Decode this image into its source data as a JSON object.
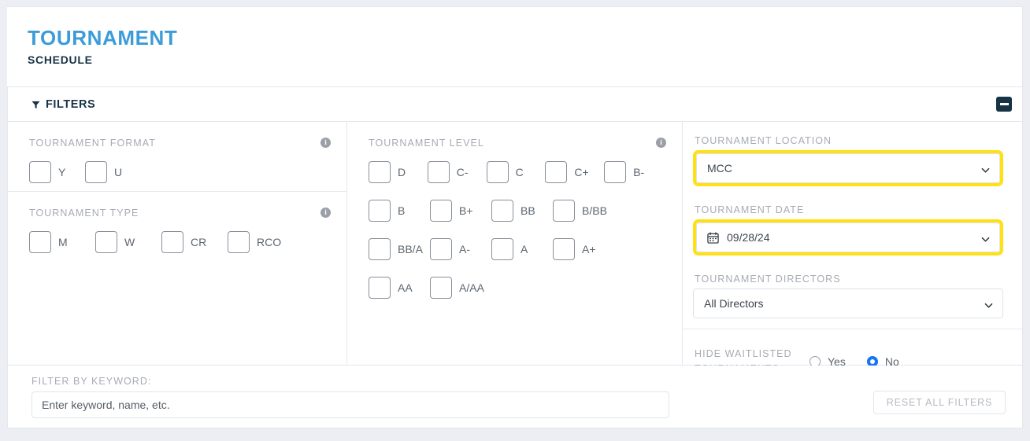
{
  "header": {
    "title": "TOURNAMENT",
    "subtitle": "SCHEDULE",
    "accent_color": "#2f9bd6",
    "title_color": "#3b9cd9"
  },
  "filters_bar": {
    "label": "FILTERS",
    "funnel_icon": "funnel-icon",
    "collapse_icon": "minus-icon"
  },
  "tournament_format": {
    "label": "TOURNAMENT FORMAT",
    "info_icon": "info-icon",
    "options": [
      {
        "label": "Y",
        "checked": false
      },
      {
        "label": "U",
        "checked": false
      }
    ]
  },
  "tournament_type": {
    "label": "TOURNAMENT TYPE",
    "info_icon": "info-icon",
    "options": [
      {
        "label": "M",
        "checked": false
      },
      {
        "label": "W",
        "checked": false
      },
      {
        "label": "CR",
        "checked": false
      },
      {
        "label": "RCO",
        "checked": false
      }
    ]
  },
  "tournament_level": {
    "label": "TOURNAMENT LEVEL",
    "info_icon": "info-icon",
    "rows": [
      [
        {
          "label": "D",
          "checked": false
        },
        {
          "label": "C-",
          "checked": false
        },
        {
          "label": "C",
          "checked": false
        },
        {
          "label": "C+",
          "checked": false
        },
        {
          "label": "B-",
          "checked": false
        }
      ],
      [
        {
          "label": "B",
          "checked": false
        },
        {
          "label": "B+",
          "checked": false
        },
        {
          "label": "BB",
          "checked": false
        },
        {
          "label": "B/BB",
          "checked": false
        }
      ],
      [
        {
          "label": "BB/A",
          "checked": false
        },
        {
          "label": "A-",
          "checked": false
        },
        {
          "label": "A",
          "checked": false
        },
        {
          "label": "A+",
          "checked": false
        }
      ],
      [
        {
          "label": "AA",
          "checked": false
        },
        {
          "label": "A/AA",
          "checked": false
        }
      ]
    ]
  },
  "tournament_location": {
    "label": "TOURNAMENT LOCATION",
    "value": "MCC",
    "highlighted": true,
    "highlight_color": "#ffe014",
    "chevron_icon": "chevron-down-icon"
  },
  "tournament_date": {
    "label": "TOURNAMENT DATE",
    "value": "09/28/24",
    "highlighted": true,
    "highlight_color": "#ffe014",
    "calendar_icon": "calendar-icon",
    "chevron_icon": "chevron-down-icon"
  },
  "tournament_directors": {
    "label": "TOURNAMENT DIRECTORS",
    "value": "All Directors",
    "chevron_icon": "chevron-down-icon"
  },
  "hide_waitlisted": {
    "label": "HIDE WAITLISTED TOURNAMENTS",
    "options": [
      {
        "label": "Yes",
        "selected": false
      },
      {
        "label": "No",
        "selected": true
      }
    ],
    "selected_color": "#1675ef"
  },
  "footer": {
    "keyword_label": "FILTER BY KEYWORD:",
    "keyword_value": "",
    "keyword_placeholder": "Enter keyword, name, etc.",
    "reset_label": "RESET ALL FILTERS"
  }
}
